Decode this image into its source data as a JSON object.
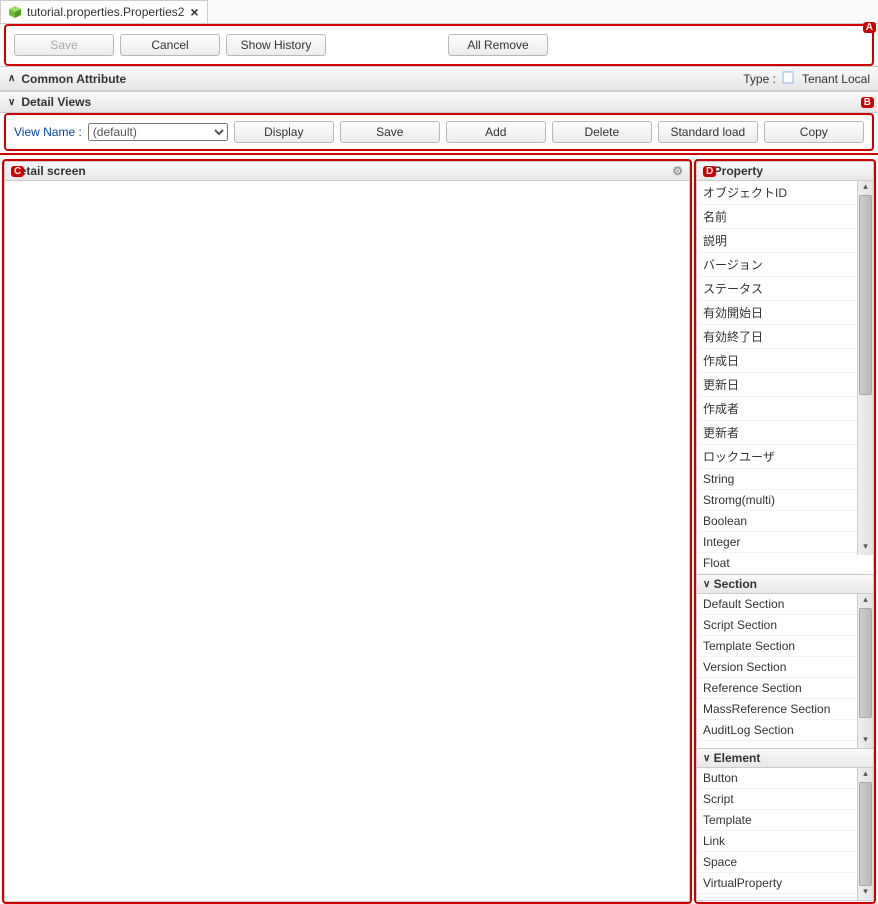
{
  "tab": {
    "title": "tutorial.properties.Properties2",
    "close": "×"
  },
  "toolbar": {
    "save": "Save",
    "cancel": "Cancel",
    "history": "Show History",
    "all_remove": "All Remove"
  },
  "common_attr": {
    "title": "Common Attribute",
    "type_label": "Type :",
    "type_value": "Tenant Local"
  },
  "detail_views": {
    "title": "Detail Views"
  },
  "viewbar": {
    "label": "View Name :",
    "selected": "(default)",
    "display": "Display",
    "save": "Save",
    "add": "Add",
    "delete": "Delete",
    "standard_load": "Standard load",
    "copy": "Copy"
  },
  "detail_screen": {
    "title": "Detail screen"
  },
  "property_panel": {
    "title": "Property",
    "items": [
      "オブジェクトID",
      "名前",
      "説明",
      "バージョン",
      "ステータス",
      "有効開始日",
      "有効終了日",
      "作成日",
      "更新日",
      "作成者",
      "更新者",
      "ロックユーザ",
      "String",
      "Stromg(multi)",
      "Boolean",
      "Integer",
      "Float"
    ]
  },
  "section_panel": {
    "title": "Section",
    "items": [
      "Default Section",
      "Script Section",
      "Template Section",
      "Version Section",
      "Reference Section",
      "MassReference Section",
      "AuditLog Section"
    ]
  },
  "element_panel": {
    "title": "Element",
    "items": [
      "Button",
      "Script",
      "Template",
      "Link",
      "Space",
      "VirtualProperty"
    ]
  },
  "annots": {
    "a": "A",
    "b": "B",
    "c": "C",
    "d": "D"
  }
}
